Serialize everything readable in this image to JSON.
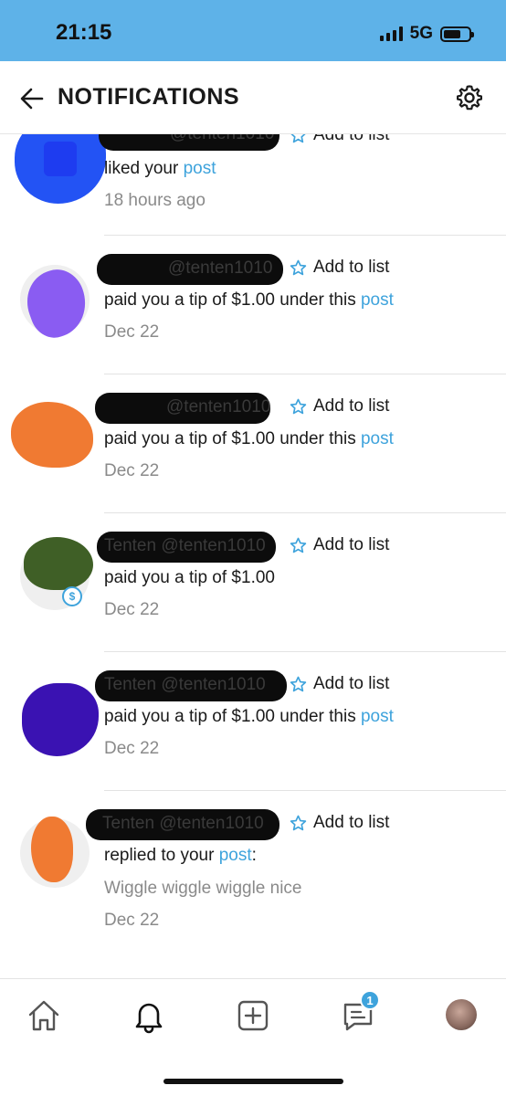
{
  "status_bar": {
    "time": "21:15",
    "network": "5G"
  },
  "header": {
    "title": "NOTIFICATIONS"
  },
  "notifications": [
    {
      "name_ghost": "@tenten1010",
      "add_to_list": "Add to list",
      "text": "liked your ",
      "link": "post",
      "suffix": "",
      "time": "18 hours ago"
    },
    {
      "name_ghost": "@tenten1010",
      "add_to_list": "Add to list",
      "text": "paid you a tip of $1.00 under this ",
      "link": "post",
      "suffix": "",
      "time": "Dec 22"
    },
    {
      "name_ghost": "@tenten1010",
      "add_to_list": "Add to list",
      "text": "paid you a tip of $1.00 under this ",
      "link": "post",
      "suffix": "",
      "time": "Dec 22"
    },
    {
      "name_ghost": "Tenten @tenten1010",
      "add_to_list": "Add to list",
      "text": "paid you a tip of $1.00",
      "link": "",
      "suffix": "",
      "time": "Dec 22"
    },
    {
      "name_ghost": "Tenten @tenten1010",
      "add_to_list": "Add to list",
      "text": "paid you a tip of $1.00 under this ",
      "link": "post",
      "suffix": "",
      "time": "Dec 22"
    },
    {
      "name_ghost": "Tenten @tenten1010",
      "add_to_list": "Add to list",
      "text": "replied to your ",
      "link": "post",
      "suffix": ":",
      "comment": "Wiggle wiggle wiggle nice",
      "time": "Dec 22"
    }
  ],
  "tab_bar": {
    "messages_badge": "1"
  },
  "colors": {
    "status_bar": "#5eb2e8",
    "accent": "#3ea3dc",
    "muted_text": "#8a8a8a"
  }
}
